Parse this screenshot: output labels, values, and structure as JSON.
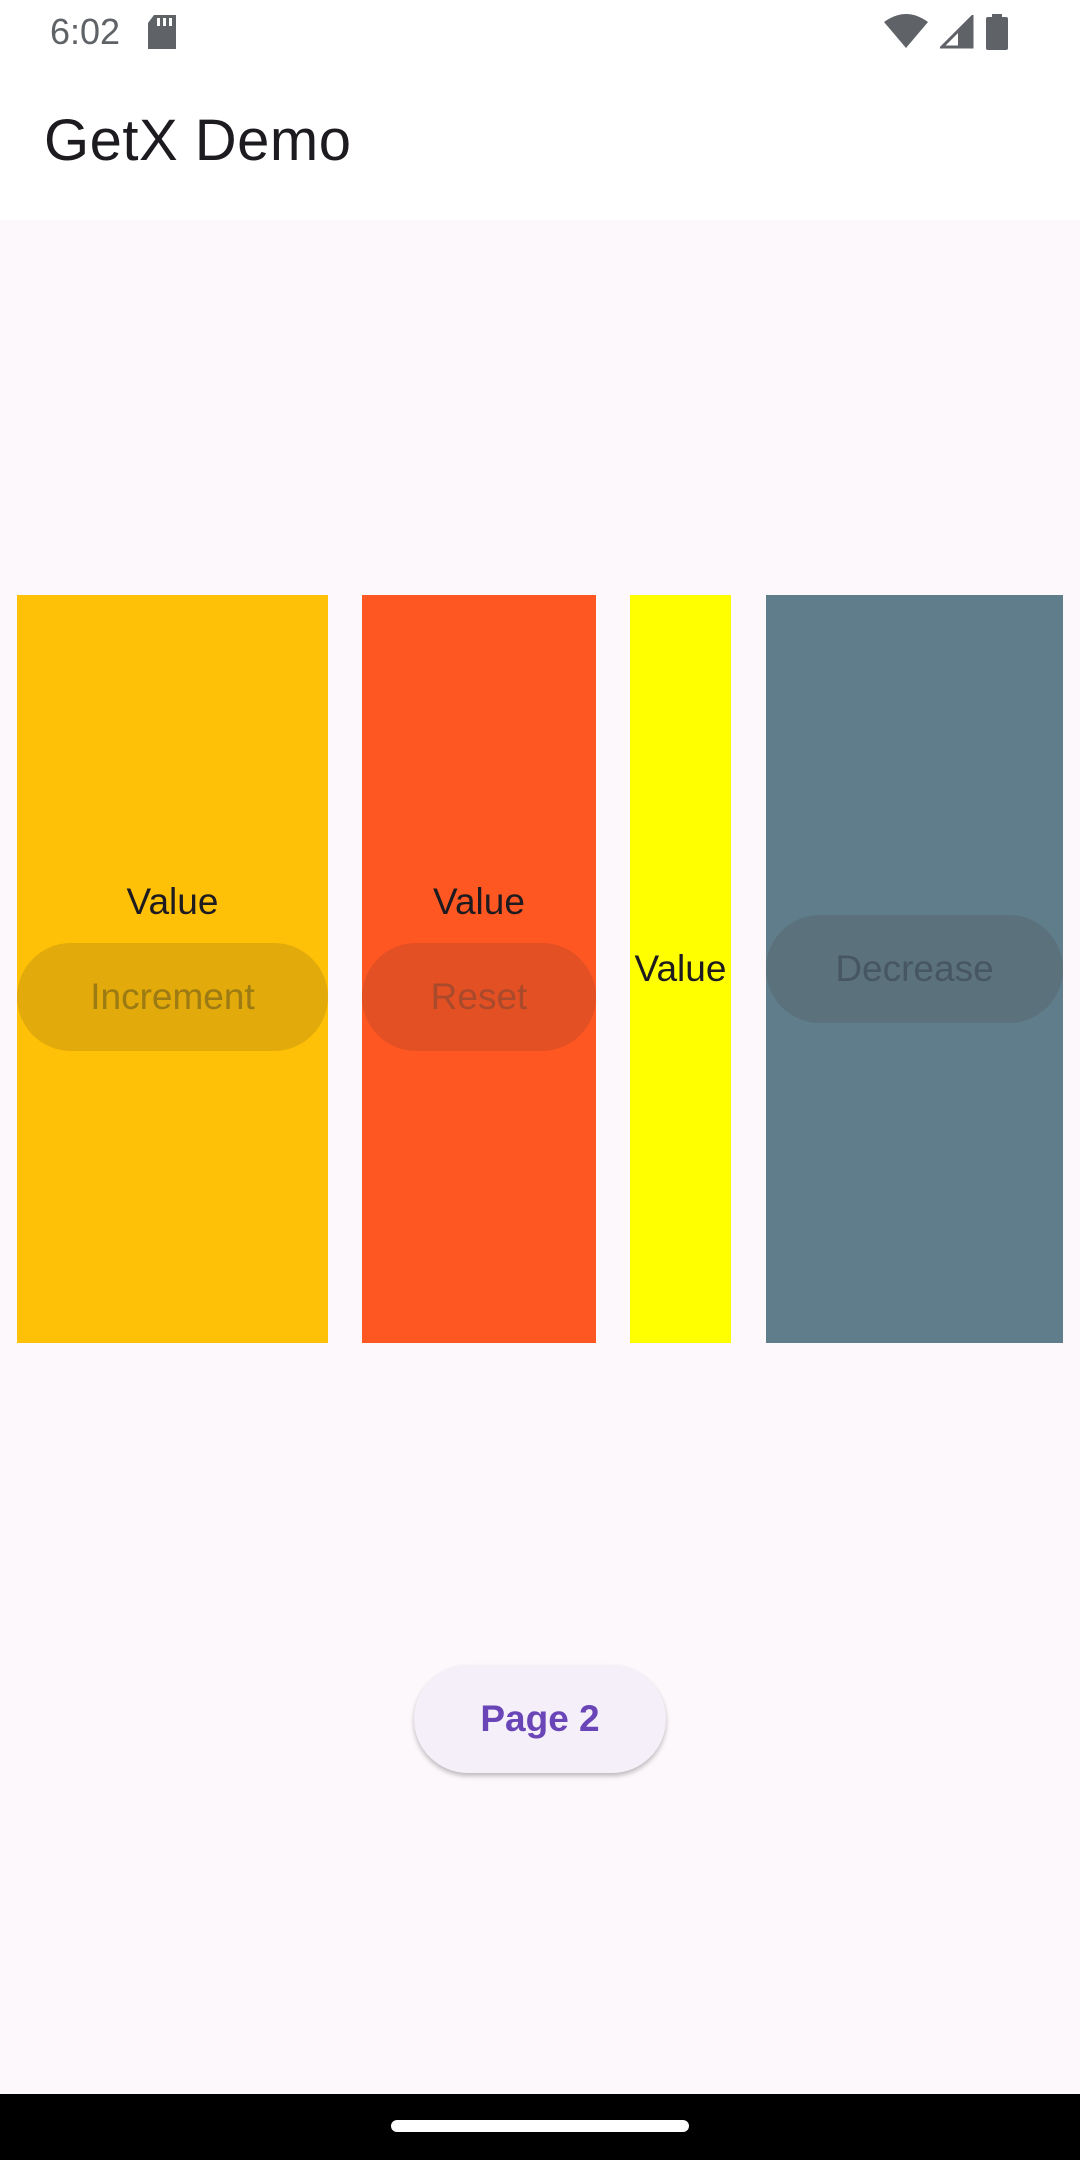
{
  "status_bar": {
    "time": "6:02",
    "icons": [
      "sd-card-icon",
      "wifi-icon",
      "signal-icon",
      "battery-icon"
    ]
  },
  "app_bar": {
    "title": "GetX Demo"
  },
  "panels": {
    "amber": {
      "value_label": "Value",
      "button_label": "Increment",
      "color": "#ffc107"
    },
    "orange": {
      "value_label": "Value",
      "button_label": "Reset",
      "color": "#ff5722"
    },
    "yellow": {
      "value_label": "Value",
      "color": "#ffff00"
    },
    "gray": {
      "button_label": "Decrease",
      "color": "#607d8b"
    }
  },
  "page2_button": {
    "label": "Page 2"
  },
  "colors": {
    "background": "#fdf8fc",
    "accent": "#6a45b8"
  }
}
